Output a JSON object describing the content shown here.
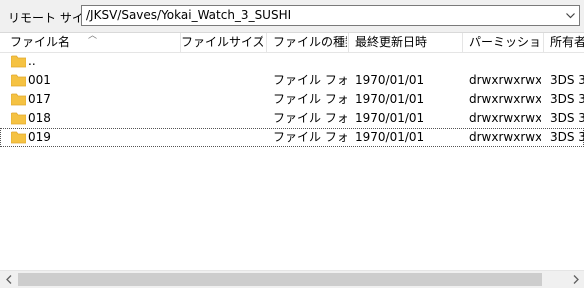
{
  "path_bar": {
    "label": "リモート サイト:",
    "path": "/JKSV/Saves/Yokai_Watch_3_SUSHI"
  },
  "columns": [
    "ファイル名",
    "ファイルサイズ",
    "ファイルの種類",
    "最終更新日時",
    "パーミッション",
    "所有者"
  ],
  "rows": [
    {
      "name": "..",
      "size": "",
      "type": "",
      "modified": "",
      "perms": "",
      "owner": ""
    },
    {
      "name": "001",
      "size": "",
      "type": "ファイル フォ...",
      "modified": "1970/01/01",
      "perms": "drwxrwxrwx",
      "owner": "3DS 3"
    },
    {
      "name": "017",
      "size": "",
      "type": "ファイル フォ...",
      "modified": "1970/01/01",
      "perms": "drwxrwxrwx",
      "owner": "3DS 3"
    },
    {
      "name": "018",
      "size": "",
      "type": "ファイル フォ...",
      "modified": "1970/01/01",
      "perms": "drwxrwxrwx",
      "owner": "3DS 3"
    },
    {
      "name": "019",
      "size": "",
      "type": "ファイル フォ...",
      "modified": "1970/01/01",
      "perms": "drwxrwxrwx",
      "owner": "3DS 3"
    }
  ],
  "colors": {
    "folder": "#f5c242",
    "folder_dark": "#e0a82e",
    "scroll_thumb": "#cdcdcd"
  }
}
